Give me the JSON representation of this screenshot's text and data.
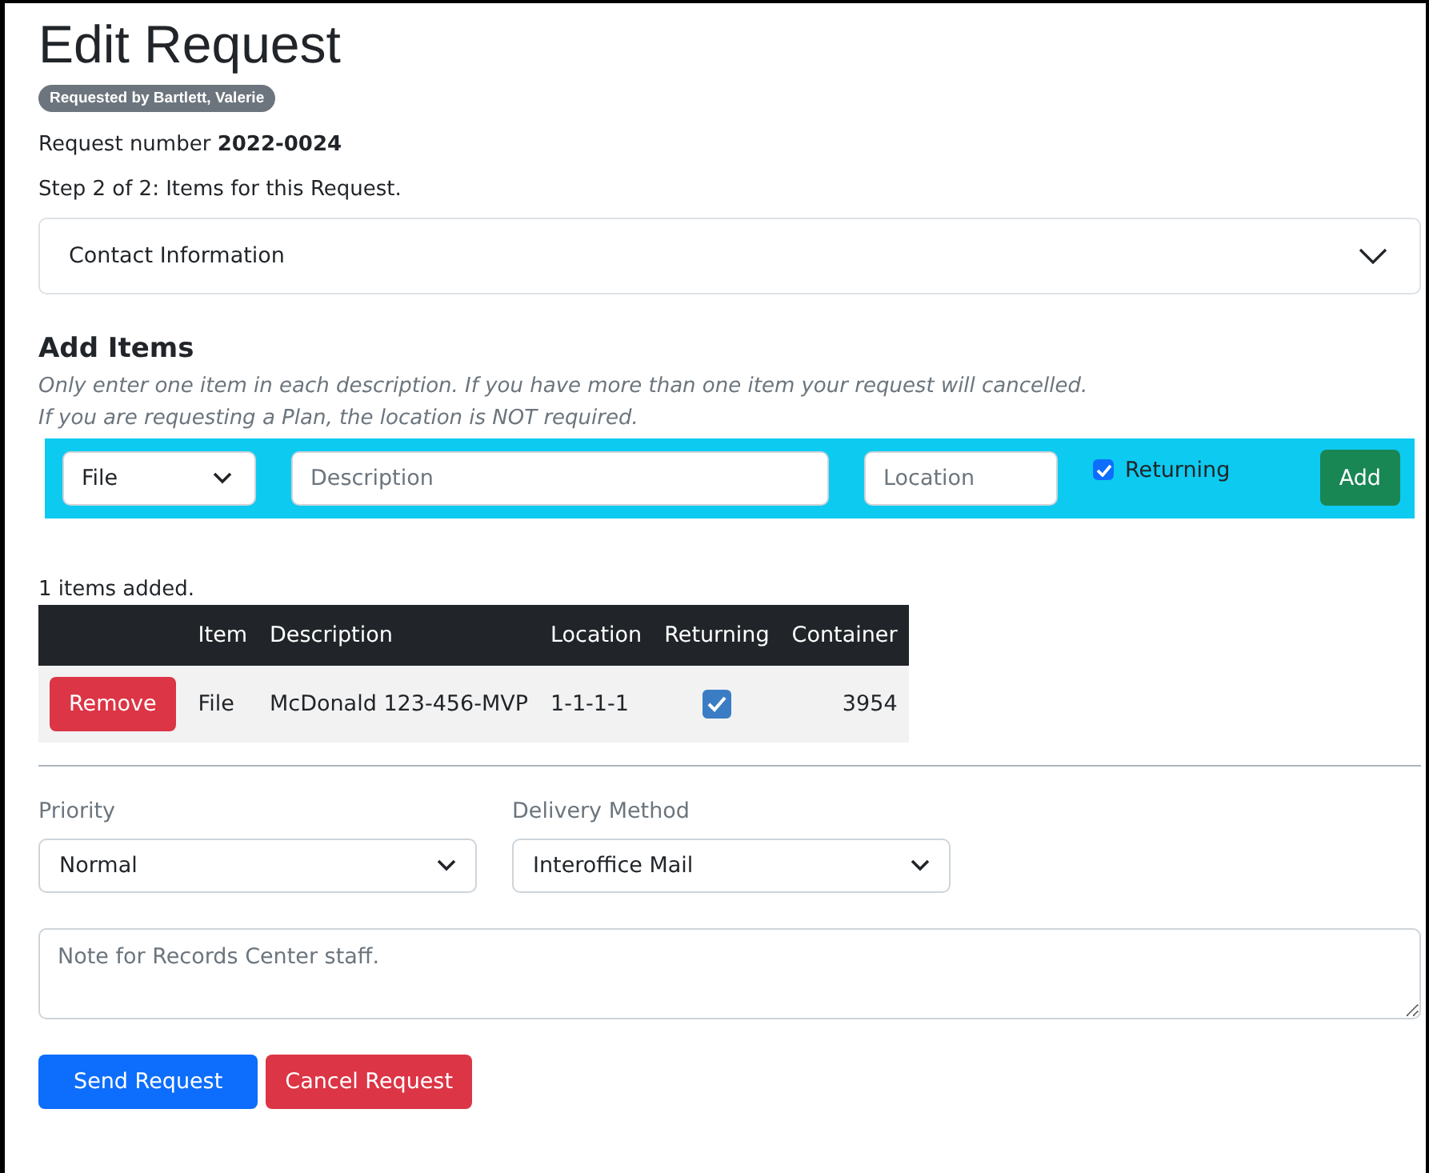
{
  "title": "Edit Request",
  "requested_by": "Requested by Bartlett, Valerie",
  "request_number": {
    "label": "Request number",
    "value": "2022-0024"
  },
  "step": "Step 2 of 2: Items for this Request.",
  "contact_section": {
    "label": "Contact Information",
    "expanded": false
  },
  "add_items": {
    "heading": "Add Items",
    "notes": [
      "Only enter one item in each description. If you have more than one item your request will cancelled.",
      "If you are requesting a Plan, the location is NOT required."
    ],
    "item_type": "File",
    "description": {
      "placeholder": "Description"
    },
    "location": {
      "placeholder": "Location"
    },
    "returning": {
      "label": "Returning",
      "checked": true
    },
    "add_button": "Add"
  },
  "items_count": "1 items added.",
  "table": {
    "columns": [
      "Item",
      "Description",
      "Location",
      "Returning",
      "Container"
    ],
    "rows": [
      {
        "action": "Remove",
        "item": "File",
        "description": "McDonald 123-456-MVP",
        "location": "1-1-1-1",
        "returning": true,
        "container": "3954"
      }
    ]
  },
  "priority": {
    "label": "Priority",
    "value": "Normal"
  },
  "delivery_method": {
    "label": "Delivery Method",
    "value": "Interoffice Mail"
  },
  "note": {
    "placeholder": "Note for Records Center staff."
  },
  "buttons": [
    {
      "label": "Send Request",
      "kind": "primary"
    },
    {
      "label": "Cancel Request",
      "kind": "danger"
    }
  ]
}
